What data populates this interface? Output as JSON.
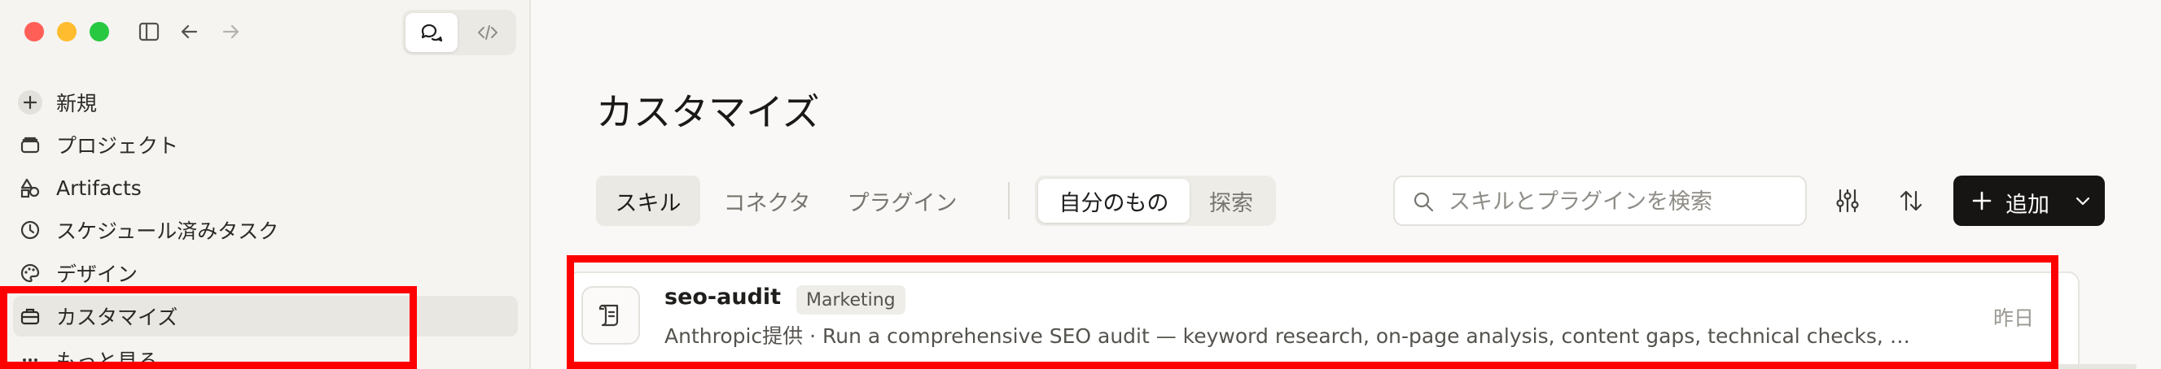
{
  "window": {
    "view_toggle": {
      "chat_icon": "chat-bubbles-icon",
      "code_icon": "code-icon"
    }
  },
  "sidebar": {
    "items": [
      {
        "label": "新規",
        "icon": "plus-icon"
      },
      {
        "label": "プロジェクト",
        "icon": "folder-icon"
      },
      {
        "label": "Artifacts",
        "icon": "shapes-icon"
      },
      {
        "label": "スケジュール済みタスク",
        "icon": "clock-icon"
      },
      {
        "label": "デザイン",
        "icon": "palette-icon"
      },
      {
        "label": "カスタマイズ",
        "icon": "briefcase-icon",
        "active": true
      },
      {
        "label": "もっと見る",
        "icon": "more-icon"
      }
    ]
  },
  "main": {
    "title": "カスタマイズ",
    "tabs": [
      {
        "label": "スキル",
        "active": true
      },
      {
        "label": "コネクタ"
      },
      {
        "label": "プラグイン"
      }
    ],
    "scope": {
      "mine": "自分のもの",
      "explore": "探索"
    },
    "search": {
      "placeholder": "スキルとプラグインを検索"
    },
    "add_button": "追加",
    "skills": [
      {
        "name": "seo-audit",
        "tag": "Marketing",
        "description": "Anthropic提供 · Run a comprehensive SEO audit — keyword research, on-page analysis, content gaps, technical checks, an…",
        "updated": "昨日"
      }
    ]
  },
  "colors": {
    "highlight": "#ff0000",
    "accent": "#161513"
  }
}
